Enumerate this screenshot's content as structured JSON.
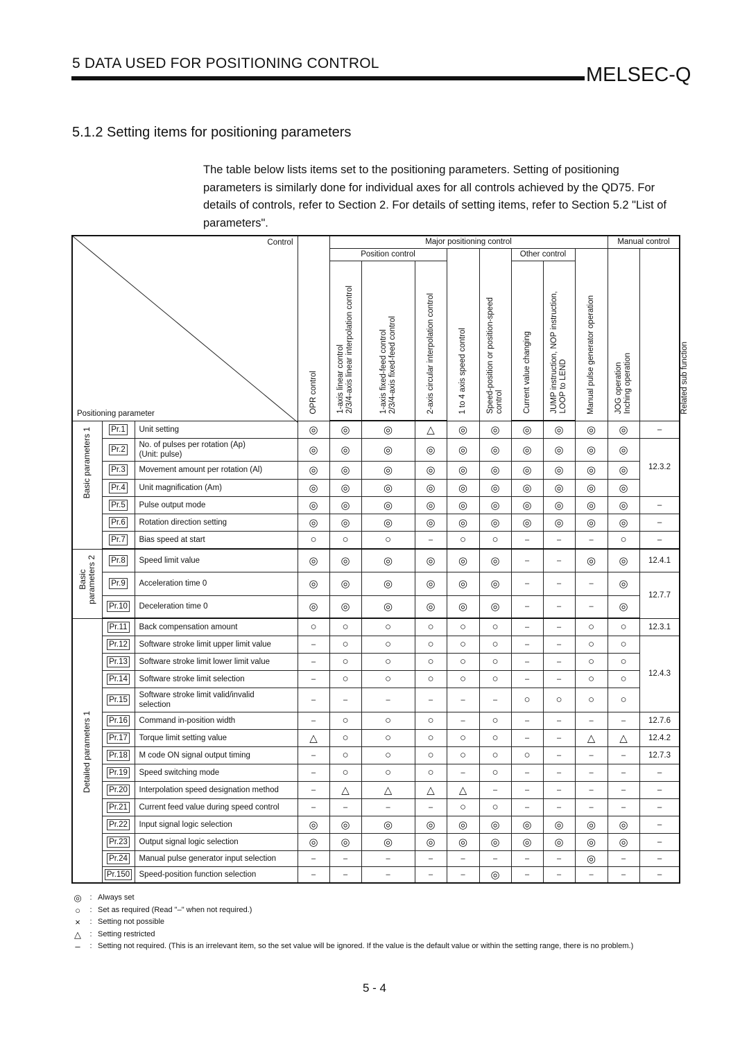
{
  "header": {
    "chapter": "5  DATA USED FOR POSITIONING CONTROL",
    "brand": "MELSEC-Q"
  },
  "section_title": "5.1.2 Setting items for positioning parameters",
  "intro": "The table below lists items set to the positioning parameters. Setting of positioning parameters is similarly done for individual axes for all controls achieved by the QD75. For details of controls, refer to Section 2. For details of setting items, refer to Section 5.2 \"List of parameters\".",
  "table": {
    "control_label": "Control",
    "param_label": "Positioning parameter",
    "opr": "OPR control",
    "major": "Major positioning control",
    "position_control": "Position control",
    "linear": [
      "1-axis linear control",
      "2/3/4-axis linear interpolation control"
    ],
    "fixed": [
      "1-axis fixed-feed control",
      "2/3/4-axis fixed-feed control"
    ],
    "circular": "2-axis circular interpolation control",
    "speed": "1 to 4 axis speed control",
    "speedpos": [
      "Speed-position or position-speed",
      "control"
    ],
    "other_control": "Other control",
    "current": "Current  value changing",
    "jump": [
      "JUMP instruction, NOP instruction,",
      "LOOP to LEND"
    ],
    "manual": "Manual control",
    "mpg": "Manual pulse generator operation",
    "jog": [
      "JOG operation",
      "Inching operation"
    ],
    "related": "Related sub function",
    "groups": {
      "basic1": "Basic parameters 1",
      "basic2": [
        "Basic",
        "parameters 2"
      ],
      "detailed1": "Detailed parameters 1"
    },
    "rows": [
      {
        "pr": "Pr.1",
        "name": "Unit setting",
        "v": [
          "◎",
          "◎",
          "◎",
          "△",
          "◎",
          "◎",
          "◎",
          "◎",
          "◎",
          "◎"
        ],
        "rel": "–"
      },
      {
        "pr": "Pr.2",
        "name": "No. of pulses per rotation (Ap)\n(Unit: pulse)",
        "v": [
          "◎",
          "◎",
          "◎",
          "◎",
          "◎",
          "◎",
          "◎",
          "◎",
          "◎",
          "◎"
        ],
        "rel": "12.3.2",
        "relspan": 3
      },
      {
        "pr": "Pr.3",
        "name": "Movement amount per rotation (Al)",
        "v": [
          "◎",
          "◎",
          "◎",
          "◎",
          "◎",
          "◎",
          "◎",
          "◎",
          "◎",
          "◎"
        ]
      },
      {
        "pr": "Pr.4",
        "name": "Unit magnification (Am)",
        "v": [
          "◎",
          "◎",
          "◎",
          "◎",
          "◎",
          "◎",
          "◎",
          "◎",
          "◎",
          "◎"
        ]
      },
      {
        "pr": "Pr.5",
        "name": "Pulse output mode",
        "v": [
          "◎",
          "◎",
          "◎",
          "◎",
          "◎",
          "◎",
          "◎",
          "◎",
          "◎",
          "◎"
        ],
        "rel": "–"
      },
      {
        "pr": "Pr.6",
        "name": "Rotation direction setting",
        "v": [
          "◎",
          "◎",
          "◎",
          "◎",
          "◎",
          "◎",
          "◎",
          "◎",
          "◎",
          "◎"
        ],
        "rel": "–"
      },
      {
        "pr": "Pr.7",
        "name": "Bias speed at start",
        "v": [
          "○",
          "○",
          "○",
          "–",
          "○",
          "○",
          "–",
          "–",
          "–",
          "○"
        ],
        "rel": "–"
      },
      {
        "pr": "Pr.8",
        "name": "Speed limit value",
        "v": [
          "◎",
          "◎",
          "◎",
          "◎",
          "◎",
          "◎",
          "–",
          "–",
          "◎",
          "◎"
        ],
        "rel": "12.4.1"
      },
      {
        "pr": "Pr.9",
        "name": "Acceleration time 0",
        "v": [
          "◎",
          "◎",
          "◎",
          "◎",
          "◎",
          "◎",
          "–",
          "–",
          "–",
          "◎"
        ],
        "rel": "12.7.7",
        "relspan": 2
      },
      {
        "pr": "Pr.10",
        "name": "Deceleration time 0",
        "v": [
          "◎",
          "◎",
          "◎",
          "◎",
          "◎",
          "◎",
          "–",
          "–",
          "–",
          "◎"
        ]
      },
      {
        "pr": "Pr.11",
        "name": "Back compensation amount",
        "v": [
          "○",
          "○",
          "○",
          "○",
          "○",
          "○",
          "–",
          "–",
          "○",
          "○"
        ],
        "rel": "12.3.1"
      },
      {
        "pr": "Pr.12",
        "name": "Software stroke limit upper limit value",
        "v": [
          "–",
          "○",
          "○",
          "○",
          "○",
          "○",
          "–",
          "–",
          "○",
          "○"
        ],
        "rel": "12.4.3",
        "relspan": 4
      },
      {
        "pr": "Pr.13",
        "name": "Software stroke limit lower limit value",
        "v": [
          "–",
          "○",
          "○",
          "○",
          "○",
          "○",
          "–",
          "–",
          "○",
          "○"
        ]
      },
      {
        "pr": "Pr.14",
        "name": "Software stroke limit selection",
        "v": [
          "–",
          "○",
          "○",
          "○",
          "○",
          "○",
          "–",
          "–",
          "○",
          "○"
        ]
      },
      {
        "pr": "Pr.15",
        "name": "Software stroke limit valid/invalid\nselection",
        "v": [
          "–",
          "–",
          "–",
          "–",
          "–",
          "–",
          "○",
          "○",
          "○",
          "○"
        ]
      },
      {
        "pr": "Pr.16",
        "name": "Command in-position width",
        "v": [
          "–",
          "○",
          "○",
          "○",
          "–",
          "○",
          "–",
          "–",
          "–",
          "–"
        ],
        "rel": "12.7.6"
      },
      {
        "pr": "Pr.17",
        "name": "Torque limit setting value",
        "v": [
          "△",
          "○",
          "○",
          "○",
          "○",
          "○",
          "–",
          "–",
          "△",
          "△"
        ],
        "rel": "12.4.2"
      },
      {
        "pr": "Pr.18",
        "name": "M code ON signal output timing",
        "v": [
          "–",
          "○",
          "○",
          "○",
          "○",
          "○",
          "○",
          "–",
          "–",
          "–"
        ],
        "rel": "12.7.3"
      },
      {
        "pr": "Pr.19",
        "name": "Speed switching mode",
        "v": [
          "–",
          "○",
          "○",
          "○",
          "–",
          "○",
          "–",
          "–",
          "–",
          "–"
        ],
        "rel": "–"
      },
      {
        "pr": "Pr.20",
        "name": "Interpolation speed designation method",
        "v": [
          "–",
          "△",
          "△",
          "△",
          "△",
          "–",
          "–",
          "–",
          "–",
          "–"
        ],
        "rel": "–"
      },
      {
        "pr": "Pr.21",
        "name": "Current feed value during speed control",
        "v": [
          "–",
          "–",
          "–",
          "–",
          "○",
          "○",
          "–",
          "–",
          "–",
          "–"
        ],
        "rel": "–"
      },
      {
        "pr": "Pr.22",
        "name": "Input signal logic selection",
        "v": [
          "◎",
          "◎",
          "◎",
          "◎",
          "◎",
          "◎",
          "◎",
          "◎",
          "◎",
          "◎"
        ],
        "rel": "–"
      },
      {
        "pr": "Pr.23",
        "name": "Output signal logic selection",
        "v": [
          "◎",
          "◎",
          "◎",
          "◎",
          "◎",
          "◎",
          "◎",
          "◎",
          "◎",
          "◎"
        ],
        "rel": "–"
      },
      {
        "pr": "Pr.24",
        "name": "Manual pulse generator input selection",
        "v": [
          "–",
          "–",
          "–",
          "–",
          "–",
          "–",
          "–",
          "–",
          "◎",
          "–"
        ],
        "rel": "–"
      },
      {
        "pr": "Pr.150",
        "name": "Speed-position function selection",
        "v": [
          "–",
          "–",
          "–",
          "–",
          "–",
          "◎",
          "–",
          "–",
          "–",
          "–"
        ],
        "rel": "–"
      }
    ]
  },
  "legend": [
    {
      "sym": "◎",
      "text": "Always set"
    },
    {
      "sym": "○",
      "text": "Set as required (Read \"–\" when not required.)"
    },
    {
      "sym": "×",
      "text": "Setting not possible"
    },
    {
      "sym": "△",
      "text": "Setting restricted"
    },
    {
      "sym": "–",
      "text": "Setting not required. (This is an irrelevant item, so the set value will be ignored. If the value is the default value or within the setting range, there is no problem.)"
    }
  ],
  "page_number": "5 - 4"
}
